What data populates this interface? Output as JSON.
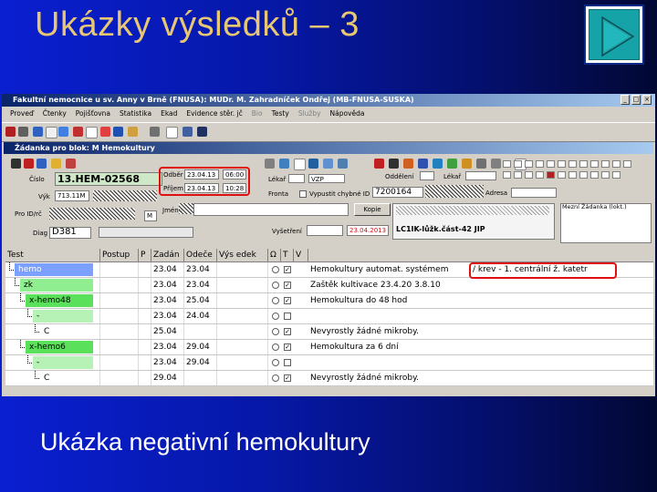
{
  "slide": {
    "title": "Ukázky výsledků – 3",
    "caption": "Ukázka negativní hemokultury",
    "play_icon": "play-triangle-icon"
  },
  "window": {
    "title": "Fakultní nemocnice u sv. Anny v Brně (FNUSA): MUDr. M. Zahradníček Ondřej (MB-FNUSA-SUSKA)",
    "menu": [
      "Proveď",
      "Čtenky",
      "Pojišťovna",
      "Statistika",
      "Ekad",
      "Evidence stěr. jč",
      "Bio",
      "Testy",
      "Služby",
      "Nápověda"
    ]
  },
  "subwindow": {
    "title": "Žádanka pro blok: M Hemokultury"
  },
  "form": {
    "cislo_label": "Číslo",
    "cislo_value": "13.HEM-02568",
    "vyk_label": "Výk",
    "vyk_value": "713.11M",
    "pro_label": "Pro ID/rč",
    "jmeno_label": "Jméno",
    "mid_value": "M",
    "diag_label": "Diag",
    "diag_value": "D381",
    "odber_label": "Odběr",
    "odber_date": "23.04.13",
    "odber_time": "06:00",
    "prijem_label": "Příjem",
    "prijem_date": "23.04.13",
    "prijem_time": "10:28",
    "fakt_label": "Lékař",
    "vzp_value": "VZP",
    "fronta_label": "Fronta",
    "vypust_label": "Vypustit chybné ID",
    "id_value": "7200164",
    "odd_label": "Oddělení",
    "lekar_label": "Lékař",
    "kopie_label": "Kopie",
    "vysetreni_label": "Vyšetření",
    "date_red": "23.04.2013",
    "adresa_label": "Adresa",
    "pracoviste_value": "LC1IK-lůžk.část-42 JIP",
    "poznamka_label": "Mezní Žádanka (lokt.)"
  },
  "grid": {
    "columns": [
      "Test",
      "Postup",
      "P",
      "Zadán",
      "Odeče",
      "Výs edek",
      "Ω",
      "T",
      "V"
    ],
    "rows": [
      {
        "test": "hemo",
        "zad": "23.04",
        "odec": "23.04",
        "chk": true,
        "text": "Hemokultury automat. systémem",
        "color": "#7ba0ff"
      },
      {
        "test": "zk",
        "zad": "23.04",
        "odec": "23.04",
        "chk": true,
        "text": "Zaštěk kultivace        23.4.20  3.8.10",
        "color": "#8fee8f"
      },
      {
        "test": "x-hemo48",
        "zad": "23.04",
        "odec": "25.04",
        "chk": true,
        "text": "Hemokultura do 48 hod",
        "color": "#5be05b"
      },
      {
        "test": "-",
        "zad": "23.04",
        "odec": "24.04",
        "chk": false,
        "text": "",
        "color": "#b6f2b6"
      },
      {
        "test": "C",
        "zad": "25.04",
        "odec": "",
        "chk": true,
        "text": "Nevyrostly žádné mikroby.",
        "color": "#ffffff"
      },
      {
        "test": "x-hemo6",
        "zad": "23.04",
        "odec": "29.04",
        "chk": true,
        "text": "Hemokultura za 6 dní",
        "color": "#5be05b"
      },
      {
        "test": "-",
        "zad": "23.04",
        "odec": "29.04",
        "chk": false,
        "text": "",
        "color": "#b6f2b6"
      },
      {
        "test": "C",
        "zad": "29.04",
        "odec": "",
        "chk": true,
        "text": "Nevyrostly žádné mikroby.",
        "color": "#ffffff"
      }
    ],
    "note": "/ krev - 1. centrální ž. katetr"
  }
}
